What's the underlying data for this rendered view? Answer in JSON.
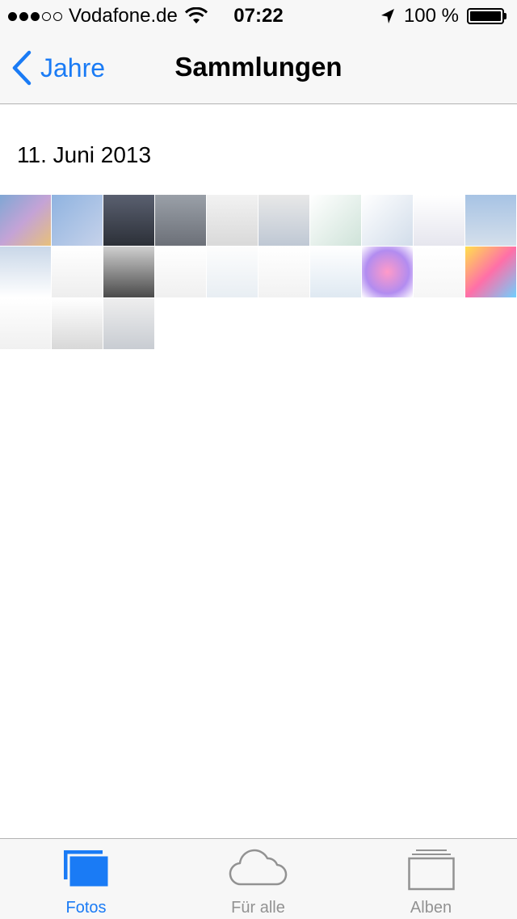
{
  "status_bar": {
    "carrier": "Vodafone.de",
    "time": "07:22",
    "battery_percent": "100 %",
    "signal_bars": 3,
    "signal_total": 5
  },
  "nav": {
    "back_label": "Jahre",
    "title": "Sammlungen"
  },
  "moments": [
    {
      "date": "11. Juni 2013",
      "photo_count": 23
    }
  ],
  "tabs": [
    {
      "label": "Fotos",
      "icon": "photos-icon",
      "active": true
    },
    {
      "label": "Für alle",
      "icon": "cloud-icon",
      "active": false
    },
    {
      "label": "Alben",
      "icon": "albums-icon",
      "active": false
    }
  ],
  "colors": {
    "accent": "#1a7bf5",
    "inactive": "#929292",
    "bar_bg": "#f7f7f7"
  }
}
